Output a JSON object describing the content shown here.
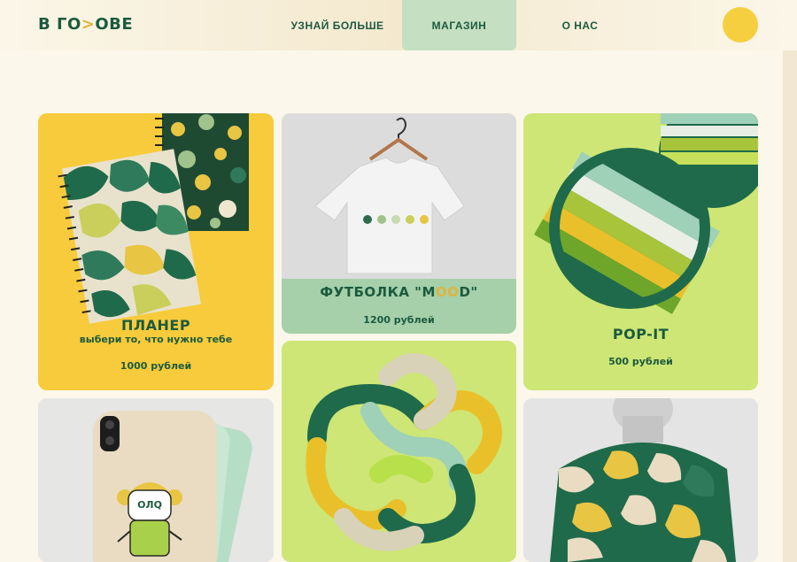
{
  "header": {
    "logo_left": "В ГО",
    "logo_accent": ">",
    "logo_right": "ОВЕ",
    "nav": {
      "learn_more": "УЗНАЙ БОЛЬШЕ",
      "shop": "МАГАЗИН",
      "about": "О НАС"
    }
  },
  "colors": {
    "background": "#fbf7ea",
    "brand_green": "#1c5a3e",
    "accent_yellow": "#f5cf3f",
    "nav_active": "#c5dfc2",
    "card_yellow": "#f7cb3b",
    "card_lime": "#cde675",
    "card_mint": "#a5d0aa"
  },
  "products": {
    "planner": {
      "title": "ПЛАНЕР",
      "subtitle": "выбери то, что нужно тебе",
      "price": "1000 рублей"
    },
    "tshirt": {
      "title_prefix": "ФУТБОЛКА \"M",
      "title_oo": "OO",
      "title_suffix": "D\"",
      "price": "1200 рублей"
    },
    "popit": {
      "title": "POP-IT",
      "price": "500 рублей"
    },
    "phone_case": {
      "sticker_text": "ОЛQ"
    }
  }
}
